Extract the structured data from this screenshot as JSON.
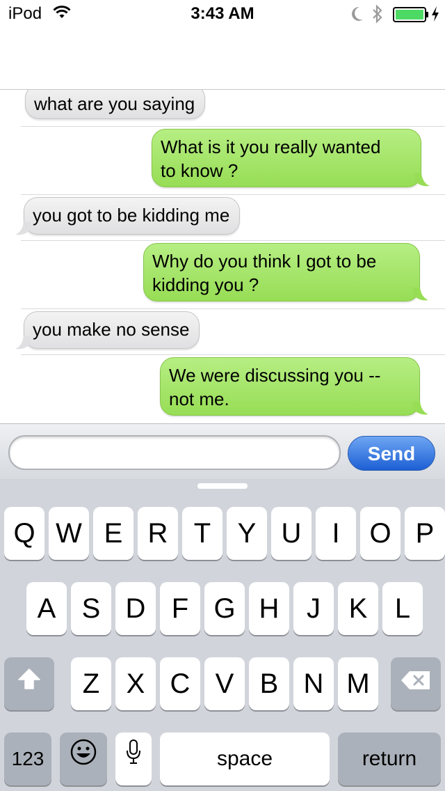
{
  "status_bar": {
    "carrier": "iPod",
    "time": "3:43 AM",
    "icons": [
      "wifi-icon",
      "moon-icon",
      "bluetooth-icon",
      "battery-icon",
      "charging-icon"
    ]
  },
  "messages": [
    {
      "direction": "incoming",
      "text": "what are you saying"
    },
    {
      "direction": "outgoing",
      "text": "What is it you really wanted\nto know ?"
    },
    {
      "direction": "incoming",
      "text": "you got to be kidding me"
    },
    {
      "direction": "outgoing",
      "text": "Why do you think I got to be\nkidding you ?"
    },
    {
      "direction": "incoming",
      "text": "you make no sense"
    },
    {
      "direction": "outgoing",
      "text": "We were discussing you --\nnot me."
    }
  ],
  "composer": {
    "value": "",
    "placeholder": "",
    "send_label": "Send"
  },
  "keyboard": {
    "row1": [
      "Q",
      "W",
      "E",
      "R",
      "T",
      "Y",
      "U",
      "I",
      "O",
      "P"
    ],
    "row2": [
      "A",
      "S",
      "D",
      "F",
      "G",
      "H",
      "J",
      "K",
      "L"
    ],
    "row3": [
      "Z",
      "X",
      "C",
      "V",
      "B",
      "N",
      "M"
    ],
    "numbers_label": "123",
    "space_label": "space",
    "return_label": "return",
    "icons": [
      "shift-icon",
      "backspace-icon",
      "emoji-icon",
      "microphone-icon"
    ]
  },
  "colors": {
    "incoming_bubble": "#e6e6e8",
    "outgoing_bubble": "#a4e46a",
    "send_button": "#2a6fe0",
    "keyboard_bg": "#d1d5db"
  }
}
